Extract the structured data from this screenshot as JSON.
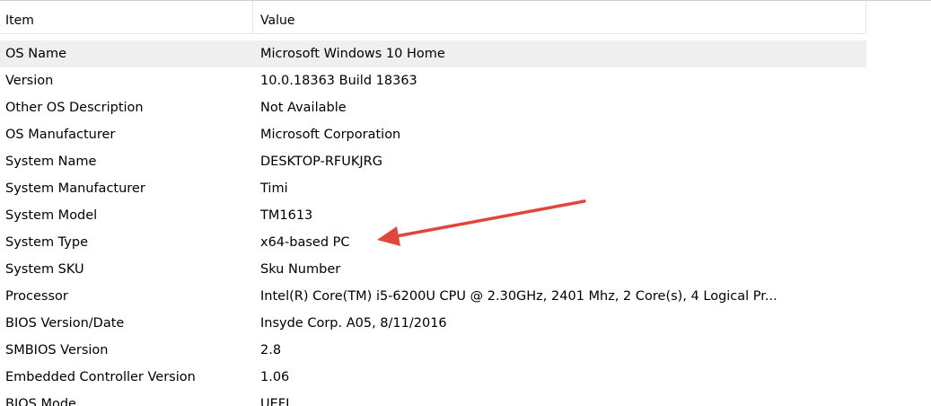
{
  "header": {
    "item_label": "Item",
    "value_label": "Value"
  },
  "rows": [
    {
      "item": "OS Name",
      "value": "Microsoft Windows 10 Home",
      "selected": true
    },
    {
      "item": "Version",
      "value": "10.0.18363 Build 18363"
    },
    {
      "item": "Other OS Description",
      "value": "Not Available"
    },
    {
      "item": "OS Manufacturer",
      "value": "Microsoft Corporation"
    },
    {
      "item": "System Name",
      "value": "DESKTOP-RFUKJRG"
    },
    {
      "item": "System Manufacturer",
      "value": "Timi"
    },
    {
      "item": "System Model",
      "value": "TM1613"
    },
    {
      "item": "System Type",
      "value": "x64-based PC"
    },
    {
      "item": "System SKU",
      "value": "Sku Number"
    },
    {
      "item": "Processor",
      "value": "Intel(R) Core(TM) i5-6200U CPU @ 2.30GHz, 2401 Mhz, 2 Core(s), 4 Logical Pr..."
    },
    {
      "item": "BIOS Version/Date",
      "value": "Insyde Corp. A05, 8/11/2016"
    },
    {
      "item": "SMBIOS Version",
      "value": "2.8"
    },
    {
      "item": "Embedded Controller Version",
      "value": "1.06"
    },
    {
      "item": "BIOS Mode",
      "value": "UEFI"
    }
  ],
  "annotation": {
    "icon": "arrow-icon",
    "color": "#e0463a"
  },
  "colors": {
    "selected_row": "#efefef",
    "header_border": "#e5e5e5"
  }
}
